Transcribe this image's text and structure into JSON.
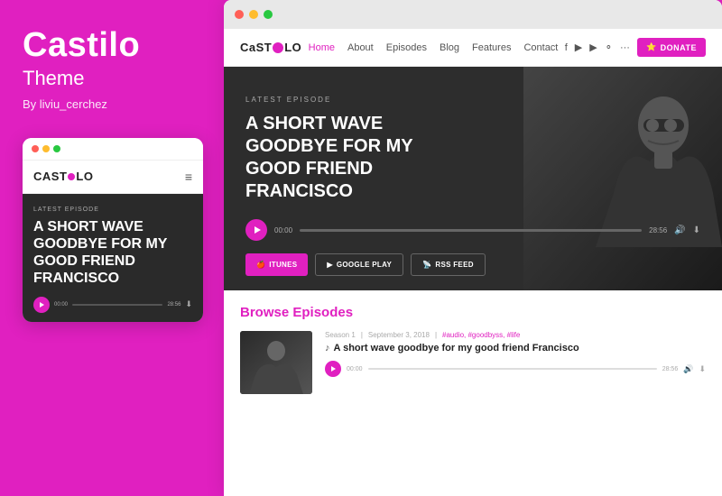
{
  "left": {
    "brand_title": "Castilo",
    "brand_subtitle": "Theme",
    "brand_author": "By liviu_cerchez"
  },
  "mobile": {
    "logo_text": "CAST",
    "logo_divider": "i",
    "logo_suffix": "LO",
    "latest_label": "LATEST EPISODE",
    "episode_title": "A SHORT WAVE GOODBYE FOR MY GOOD FRIEND FRANCISCO",
    "time_start": "00:00",
    "time_end": "28:56"
  },
  "browser": {
    "dots": [
      "#ff5f57",
      "#febc2e",
      "#28c840"
    ]
  },
  "site": {
    "logo_text": "CaST",
    "logo_suffix": "LO",
    "nav_items": [
      "Home",
      "About",
      "Episodes",
      "Blog",
      "Features",
      "Contact"
    ],
    "active_nav": "Home",
    "donate_label": "DONATE",
    "hero": {
      "latest_label": "LATEST EPISODE",
      "episode_title": "A SHORT WAVE GOODBYE FOR MY GOOD FRIEND FRANCISCO",
      "time_start": "00:00",
      "time_end": "28:56",
      "btn_itunes": "ITUNES",
      "btn_google": "GOOGLE PLAY",
      "btn_rss": "RSS FEED"
    },
    "browse": {
      "title": "Browse",
      "title_highlight": "Episodes",
      "episode_season": "Season 1",
      "episode_date": "September 3, 2018",
      "episode_tags": "#audio, #goodbyss, #life",
      "episode_title": "A short wave goodbye for my good friend Francisco",
      "time_start": "00:00",
      "time_end": "28:56"
    }
  }
}
